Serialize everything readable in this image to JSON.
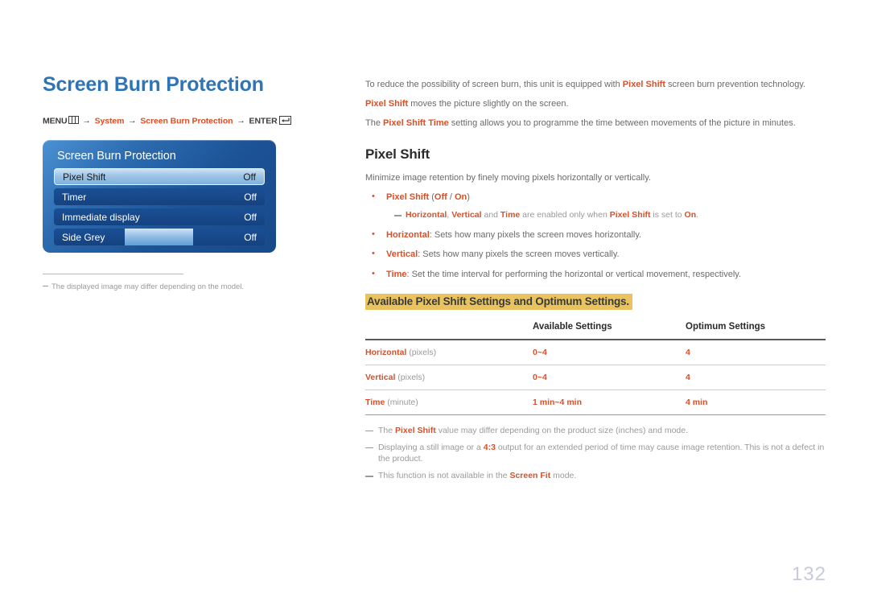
{
  "page": {
    "number": "132"
  },
  "left": {
    "title": "Screen Burn Protection",
    "breadcrumb": {
      "menu_label": "MENU",
      "menu_icon": "menu-grid-icon",
      "arrow": "→",
      "item1": "System",
      "item2": "Screen Burn Protection",
      "enter_label": "ENTER",
      "enter_icon": "enter-return-icon"
    },
    "osd": {
      "title": "Screen Burn Protection",
      "rows": [
        {
          "label": "Pixel Shift",
          "value": "Off",
          "selected": true,
          "slider": false
        },
        {
          "label": "Timer",
          "value": "Off",
          "selected": false,
          "slider": false
        },
        {
          "label": "Immediate display",
          "value": "Off",
          "selected": false,
          "slider": false
        },
        {
          "label": "Side Grey",
          "value": "Off",
          "selected": false,
          "slider": true
        }
      ]
    },
    "footnote": "The displayed image may differ depending on the model."
  },
  "right": {
    "intro_paras": [
      {
        "parts": [
          {
            "t": "To reduce the possibility of screen burn, this unit is equipped with ",
            "s": "plain"
          },
          {
            "t": "Pixel Shift",
            "s": "accent"
          },
          {
            "t": " screen burn prevention technology.",
            "s": "plain"
          }
        ]
      },
      {
        "parts": [
          {
            "t": "Pixel Shift",
            "s": "accent"
          },
          {
            "t": " moves the picture slightly on the screen.",
            "s": "plain"
          }
        ]
      },
      {
        "parts": [
          {
            "t": "The ",
            "s": "plain"
          },
          {
            "t": "Pixel Shift Time",
            "s": "accent"
          },
          {
            "t": " setting allows you to programme the time between movements of the picture in minutes.",
            "s": "plain"
          }
        ]
      }
    ],
    "section_heading": "Pixel Shift",
    "section_intro": "Minimize image retention by finely moving pixels horizontally or vertically.",
    "bullets": [
      {
        "parts": [
          {
            "t": "Pixel Shift",
            "s": "accent"
          },
          {
            "t": " (",
            "s": "plain"
          },
          {
            "t": "Off",
            "s": "accent"
          },
          {
            "t": " / ",
            "s": "plain"
          },
          {
            "t": "On",
            "s": "accent"
          },
          {
            "t": ")",
            "s": "plain"
          }
        ],
        "subnote": {
          "parts": [
            {
              "t": "Horizontal",
              "s": "accent"
            },
            {
              "t": ", ",
              "s": "plain"
            },
            {
              "t": "Vertical",
              "s": "accent"
            },
            {
              "t": " and ",
              "s": "plain"
            },
            {
              "t": "Time",
              "s": "accent"
            },
            {
              "t": " are enabled only when ",
              "s": "plain"
            },
            {
              "t": "Pixel Shift",
              "s": "accent"
            },
            {
              "t": " is set to ",
              "s": "plain"
            },
            {
              "t": "On",
              "s": "accent"
            },
            {
              "t": ".",
              "s": "plain"
            }
          ]
        }
      },
      {
        "parts": [
          {
            "t": "Horizontal",
            "s": "accent"
          },
          {
            "t": ": Sets how many pixels the screen moves horizontally.",
            "s": "plain"
          }
        ]
      },
      {
        "parts": [
          {
            "t": "Vertical",
            "s": "accent"
          },
          {
            "t": ": Sets how many pixels the screen moves vertically.",
            "s": "plain"
          }
        ]
      },
      {
        "parts": [
          {
            "t": "Time",
            "s": "accent"
          },
          {
            "t": ": Set the time interval for performing the horizontal or vertical movement, respectively.",
            "s": "plain"
          }
        ]
      }
    ],
    "highlight_heading": "Available Pixel Shift Settings and Optimum Settings.",
    "table": {
      "headers": [
        "",
        "Available Settings",
        "Optimum Settings"
      ],
      "rows": [
        {
          "name": "Horizontal",
          "unit": "(pixels)",
          "available": "0~4",
          "optimum": "4"
        },
        {
          "name": "Vertical",
          "unit": "(pixels)",
          "available": "0~4",
          "optimum": "4"
        },
        {
          "name": "Time",
          "unit": "(minute)",
          "available": "1 min~4 min",
          "optimum": "4 min"
        }
      ]
    },
    "bottom_notes": [
      {
        "parts": [
          {
            "t": "The ",
            "s": "plain"
          },
          {
            "t": "Pixel Shift",
            "s": "accent"
          },
          {
            "t": " value may differ depending on the product size (inches) and mode.",
            "s": "plain"
          }
        ]
      },
      {
        "parts": [
          {
            "t": "Displaying a still image or a ",
            "s": "plain"
          },
          {
            "t": "4:3",
            "s": "accent"
          },
          {
            "t": " output for an extended period of time may cause image retention. This is not a defect in the product.",
            "s": "plain"
          }
        ]
      },
      {
        "parts": [
          {
            "t": "This function is not available in the ",
            "s": "plain"
          },
          {
            "t": "Screen Fit",
            "s": "accent"
          },
          {
            "t": " mode.",
            "s": "plain"
          }
        ]
      }
    ]
  },
  "colors": {
    "accent": "#d8502a",
    "title_blue": "#2f75b5",
    "highlight_yellow": "#e9c45e",
    "page_number": "#c9cada"
  }
}
